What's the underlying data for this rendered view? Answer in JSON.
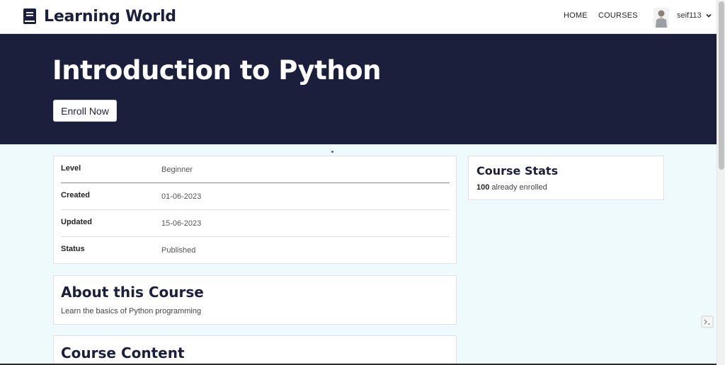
{
  "brand": {
    "name": "Learning World",
    "icon": "book-icon"
  },
  "nav": {
    "home": "HOME",
    "courses": "COURSES"
  },
  "user": {
    "name": "seif113",
    "avatar": "user-avatar"
  },
  "hero": {
    "title": "Introduction to Python",
    "enroll_label": "Enroll Now"
  },
  "details": [
    {
      "label": "Level",
      "value": "Beginner"
    },
    {
      "label": "Created",
      "value": "01-06-2023"
    },
    {
      "label": "Updated",
      "value": "15-06-2023"
    },
    {
      "label": "Status",
      "value": "Published"
    }
  ],
  "stats": {
    "title": "Course Stats",
    "enrolled_count": "100",
    "enrolled_text": "already enrolled"
  },
  "about": {
    "title": "About this Course",
    "description": "Learn the basics of Python programming"
  },
  "content": {
    "title": "Course Content"
  },
  "colors": {
    "navy": "#1b1f3b",
    "page_bg": "#eefafb",
    "card_bg": "#ffffff"
  }
}
